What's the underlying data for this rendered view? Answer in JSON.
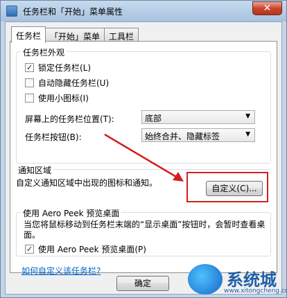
{
  "window": {
    "title": "任务栏和「开始」菜单属性",
    "close_label": "✕"
  },
  "tabs": [
    {
      "label": "任务栏",
      "active": true
    },
    {
      "label": "「开始」菜单",
      "active": false
    },
    {
      "label": "工具栏",
      "active": false
    }
  ],
  "appearance": {
    "title": "任务栏外观",
    "checkboxes": [
      {
        "label": "锁定任务栏(L)",
        "checked": true
      },
      {
        "label": "自动隐藏任务栏(U)",
        "checked": false
      },
      {
        "label": "使用小图标(I)",
        "checked": false
      }
    ],
    "position_label": "屏幕上的任务栏位置(T):",
    "position_value": "底部",
    "buttons_label": "任务栏按钮(B):",
    "buttons_value": "始终合并、隐藏标签"
  },
  "notification": {
    "title": "通知区域",
    "desc": "自定义通知区域中出现的图标和通知。",
    "button": "自定义(C)..."
  },
  "aero": {
    "title": "使用 Aero Peek 预览桌面",
    "desc": "当您将鼠标移动到任务栏末端的“显示桌面”按钮时，会暂时查看桌面。",
    "checkbox": {
      "label": "使用 Aero Peek 预览桌面(P)",
      "checked": true
    }
  },
  "help_link": "如何自定义该任务栏?",
  "footer": {
    "ok_label": "确定"
  },
  "watermark": {
    "text": "系统城",
    "url": "www.xitongcheng.com"
  },
  "colors": {
    "annotation": "#d21f1f"
  }
}
